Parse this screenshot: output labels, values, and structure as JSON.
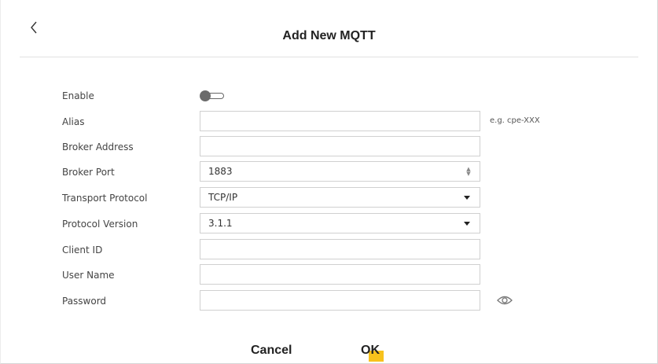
{
  "header": {
    "title": "Add New MQTT",
    "back_icon": "chevron-left-icon"
  },
  "form": {
    "enable": {
      "label": "Enable",
      "state": "off"
    },
    "alias": {
      "label": "Alias",
      "value": "",
      "hint": "e.g. cpe-XXX"
    },
    "broker_address": {
      "label": "Broker Address",
      "value": ""
    },
    "broker_port": {
      "label": "Broker Port",
      "value": "1883"
    },
    "transport_protocol": {
      "label": "Transport Protocol",
      "value": "TCP/IP"
    },
    "protocol_version": {
      "label": "Protocol Version",
      "value": "3.1.1"
    },
    "client_id": {
      "label": "Client ID",
      "value": ""
    },
    "user_name": {
      "label": "User Name",
      "value": ""
    },
    "password": {
      "label": "Password",
      "value": "",
      "reveal_icon": "eye-icon"
    }
  },
  "actions": {
    "cancel_label": "Cancel",
    "ok_label": "OK",
    "accent_color": "#f7c21c"
  }
}
